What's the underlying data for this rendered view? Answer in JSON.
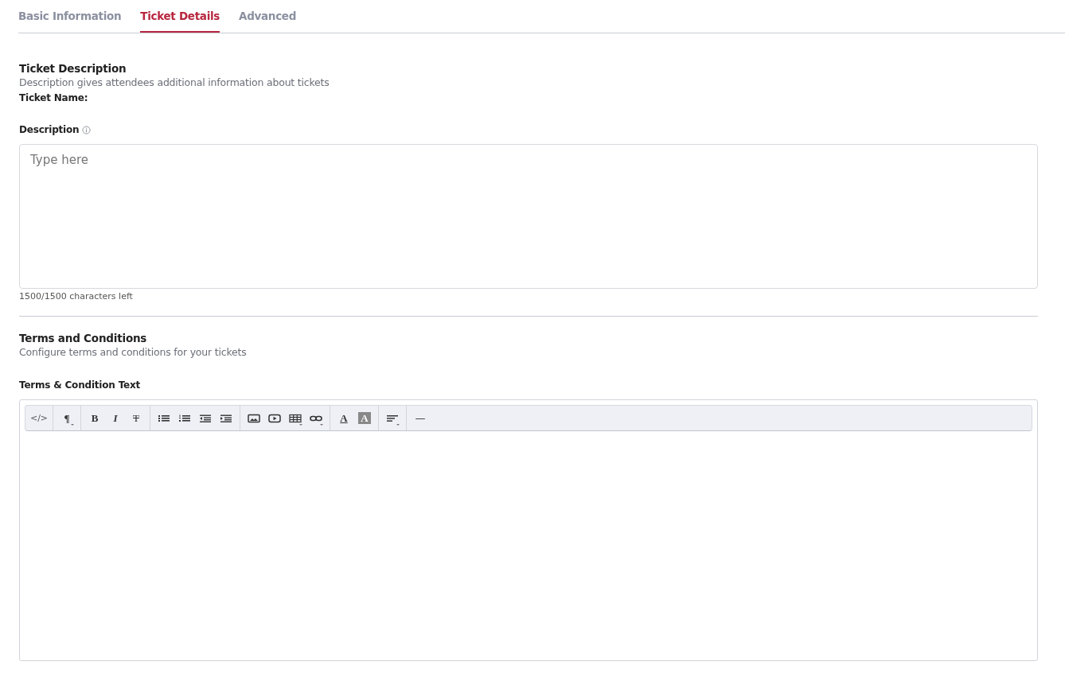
{
  "tabs": [
    {
      "label": "Basic Information",
      "selected": false
    },
    {
      "label": "Ticket Details",
      "selected": true
    },
    {
      "label": "Advanced",
      "selected": false
    }
  ],
  "ticket_description": {
    "title": "Ticket Description",
    "subtitle": "Description gives attendees additional information about tickets",
    "ticket_name_label": "Ticket Name:",
    "description_label": "Description",
    "description_field": {
      "placeholder": "Type here"
    },
    "char_count": "1500/1500 characters left"
  },
  "terms": {
    "title": "Terms and Conditions",
    "subtitle": "Configure terms and conditions for your tickets",
    "field_label": "Terms & Condition Text",
    "toolbar": [
      [
        {
          "kind": "code",
          "text": "</>"
        }
      ],
      [
        {
          "kind": "paragraph",
          "text": "¶",
          "dropdown": true
        }
      ],
      [
        {
          "kind": "bold",
          "text": "B"
        },
        {
          "kind": "italic",
          "text": "I"
        },
        {
          "kind": "strike",
          "text": "T"
        }
      ],
      [
        {
          "kind": "bullets"
        },
        {
          "kind": "numbers"
        },
        {
          "kind": "outdent"
        },
        {
          "kind": "indent"
        }
      ],
      [
        {
          "kind": "image"
        },
        {
          "kind": "video"
        },
        {
          "kind": "table",
          "dropdown": true
        },
        {
          "kind": "link",
          "dropdown": true
        }
      ],
      [
        {
          "kind": "fontcolor",
          "text": "A"
        },
        {
          "kind": "highlight",
          "text": "A"
        }
      ],
      [
        {
          "kind": "align",
          "dropdown": true
        }
      ],
      [
        {
          "kind": "rule",
          "text": "—"
        }
      ]
    ]
  }
}
